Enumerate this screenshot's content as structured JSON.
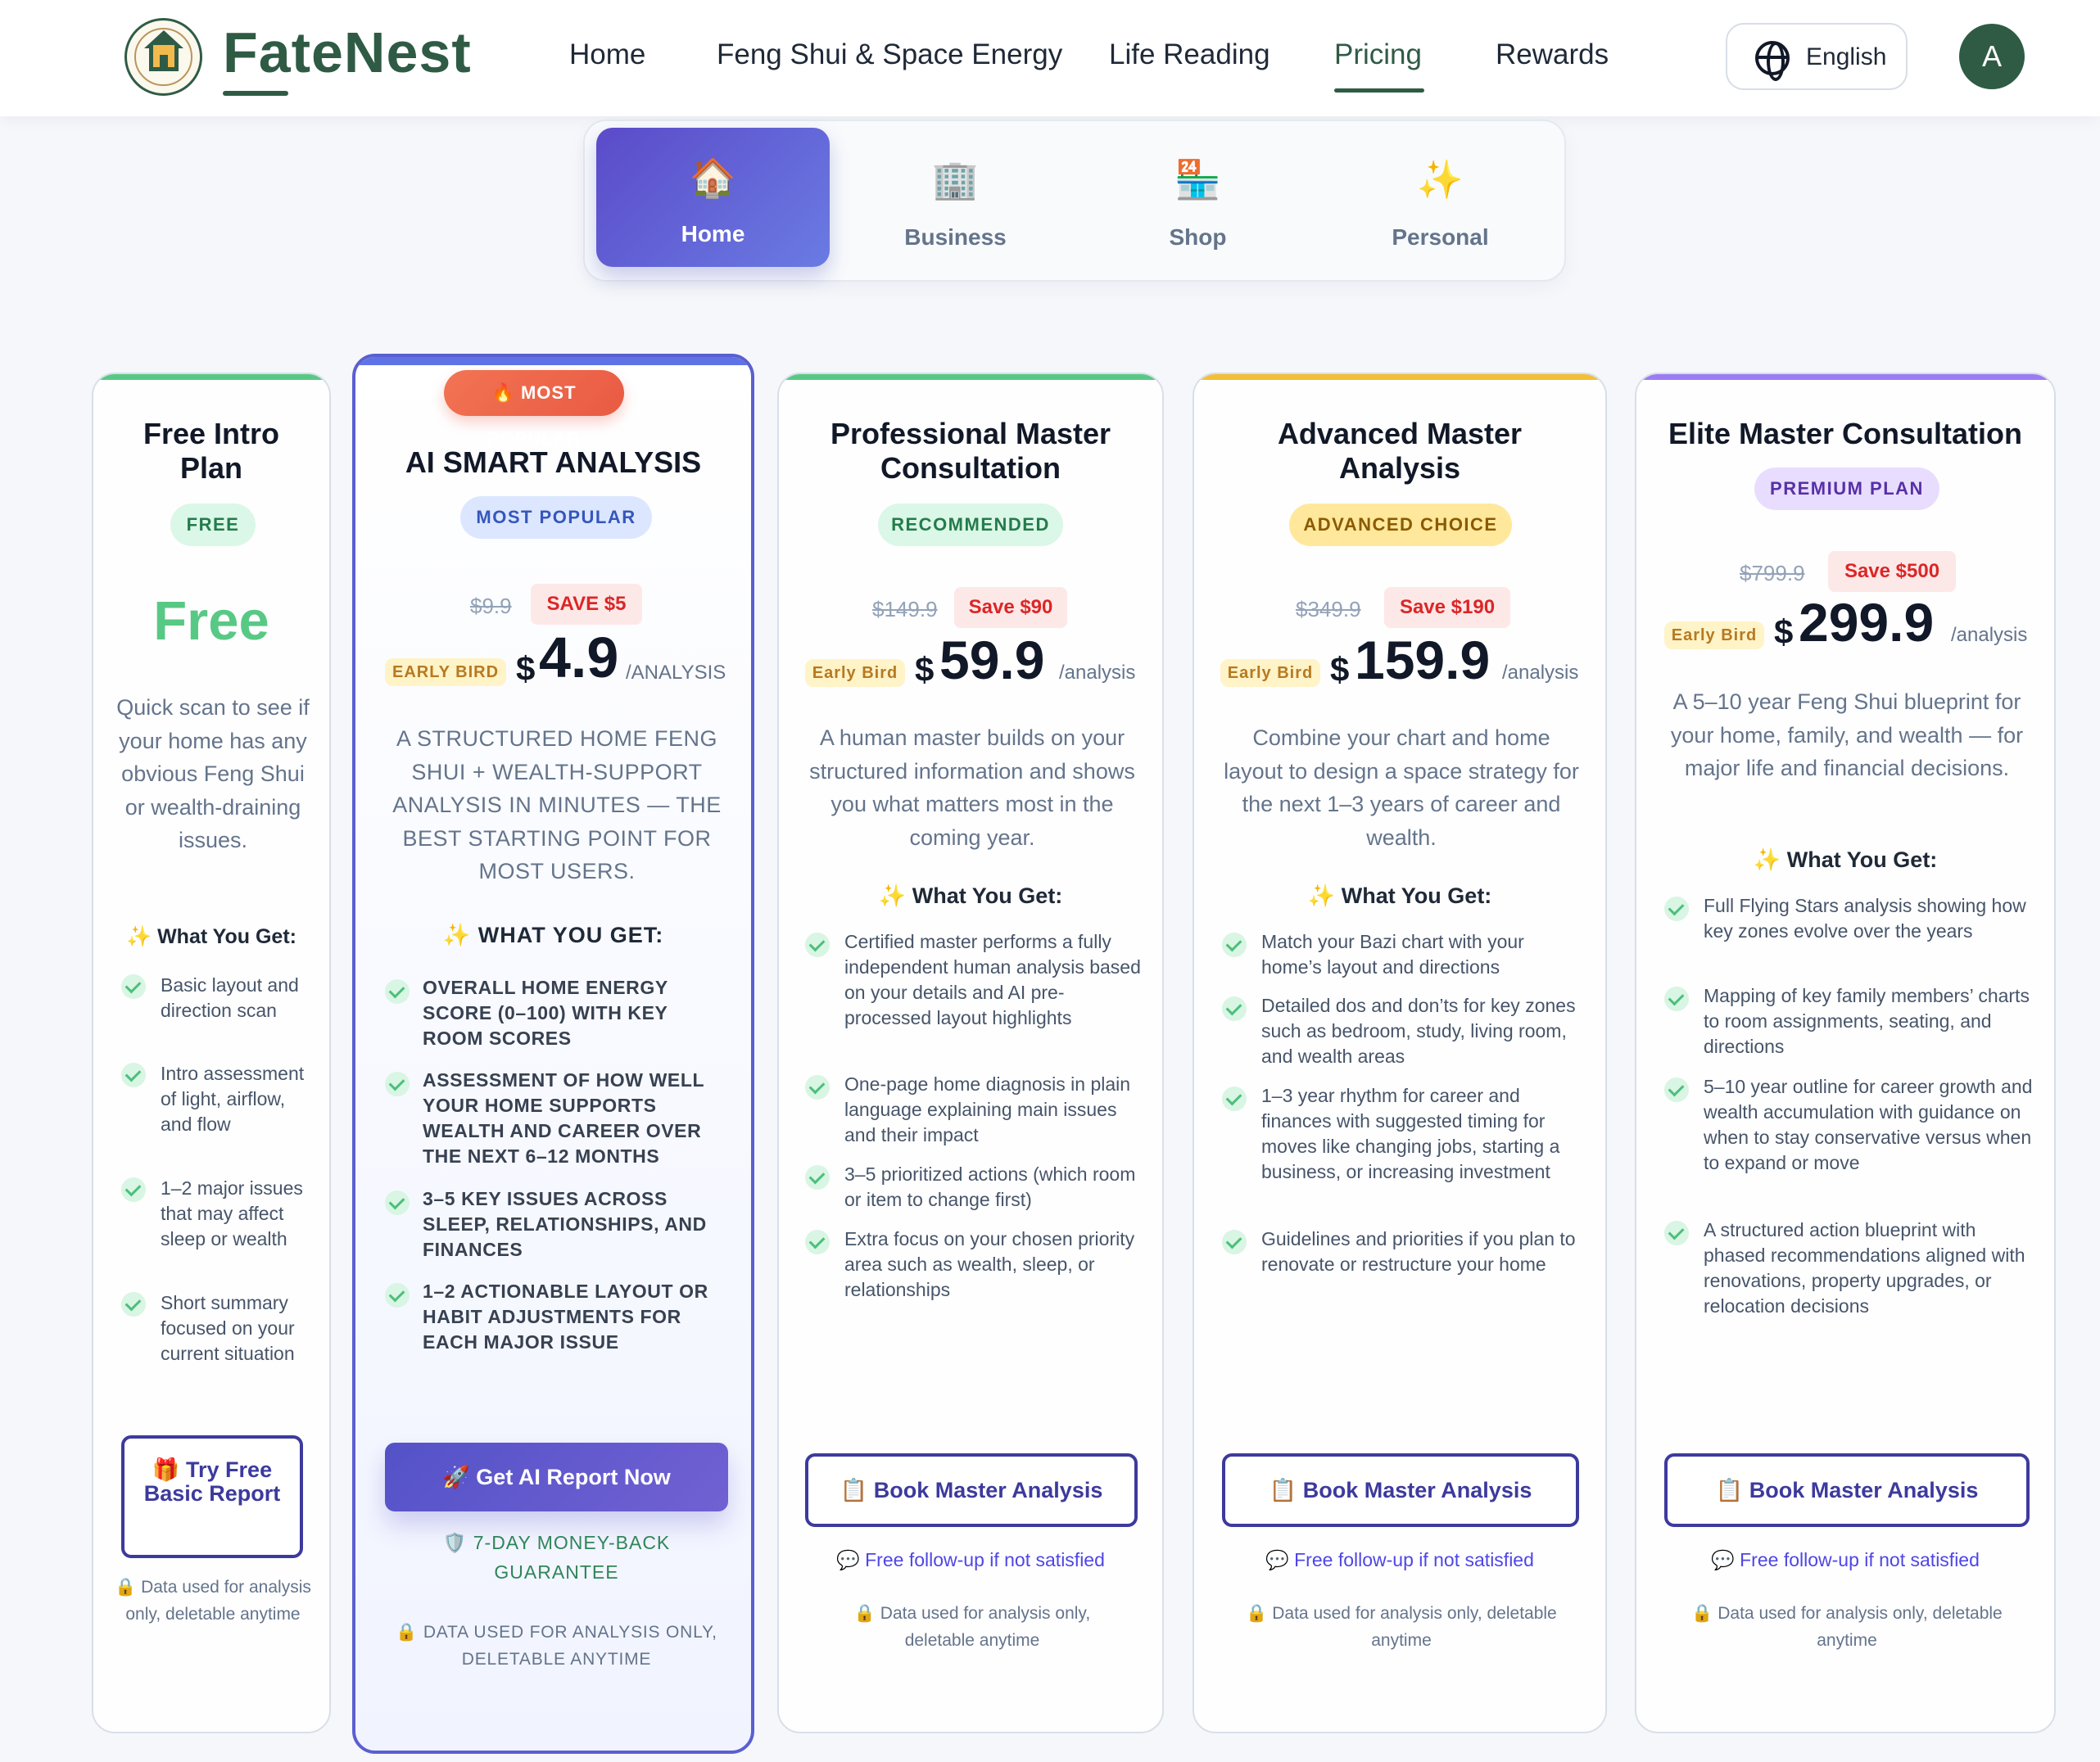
{
  "brand": {
    "name": "FateNest"
  },
  "nav": {
    "links": [
      "Home",
      "Feng Shui & Space Energy",
      "Life Reading",
      "Pricing",
      "Rewards"
    ],
    "active": "Pricing",
    "language": "English",
    "avatar": "A"
  },
  "icons": {
    "logo": "house-logo-icon",
    "globe": "globe-icon",
    "home": "house-icon",
    "business": "office-building-icon",
    "shop": "store-icon",
    "personal": "sparkles-icon",
    "check": "check-icon",
    "gift": "gift-icon",
    "rocket": "rocket-icon",
    "book": "book-icon",
    "chat": "chat-icon",
    "lock": "lock-icon",
    "shield": "shield-icon"
  },
  "colors": {
    "brand": "#2f5b45",
    "accent": "#5b4bc9",
    "success": "#58c985",
    "danger": "#dc2626",
    "warning": "#f3bf38",
    "purple": "#9b7cf3"
  },
  "segments": [
    {
      "icon": "🏠",
      "label": "Home",
      "active": true
    },
    {
      "icon": "🏢",
      "label": "Business",
      "active": false
    },
    {
      "icon": "🏪",
      "label": "Shop",
      "active": false
    },
    {
      "icon": "✨",
      "label": "Personal",
      "active": false
    }
  ],
  "plans": [
    {
      "title": "Free Intro Plan",
      "badge": "FREE",
      "price_text": "Free",
      "description": "Quick scan to see if your home has any obvious Feng Shui or wealth-draining issues.",
      "what_you_get": "✨ What You Get:",
      "features": [
        "Basic layout and direction scan",
        "Intro assessment of light, airflow, and flow",
        "1–2 major issues that may affect sleep or wealth",
        "Short summary focused on your current situation"
      ],
      "button": "🎁 Try Free Basic Report",
      "privacy": "🔒 Data used for analysis only, deletable anytime"
    },
    {
      "floating_badge": "🔥 MOST POPULAR",
      "title": "AI SMART ANALYSIS",
      "badge": "MOST POPULAR",
      "old_price": "$9.9",
      "save": "SAVE $5",
      "early_bird": "EARLY BIRD",
      "currency": "$",
      "price": "4.9",
      "unit": "/ANALYSIS",
      "description": "A STRUCTURED HOME FENG SHUI + WEALTH-SUPPORT ANALYSIS IN MINUTES — THE BEST STARTING POINT FOR MOST USERS.",
      "what_you_get": "✨ WHAT YOU GET:",
      "features": [
        "OVERALL HOME ENERGY SCORE (0–100) WITH KEY ROOM SCORES",
        "ASSESSMENT OF HOW WELL YOUR HOME SUPPORTS WEALTH AND CAREER OVER THE NEXT 6–12 MONTHS",
        "3–5 KEY ISSUES ACROSS SLEEP, RELATIONSHIPS, AND FINANCES",
        "1–2 ACTIONABLE LAYOUT OR HABIT ADJUSTMENTS FOR EACH MAJOR ISSUE"
      ],
      "button": "🚀 Get AI Report Now",
      "guarantee": "🛡️ 7-DAY MONEY-BACK GUARANTEE",
      "privacy": "🔒 DATA USED FOR ANALYSIS ONLY, DELETABLE ANYTIME"
    },
    {
      "title": "Professional Master Consultation",
      "badge": "RECOMMENDED",
      "old_price": "$149.9",
      "save": "Save $90",
      "early_bird": "Early Bird",
      "currency": "$",
      "price": "59.9",
      "unit": "/analysis",
      "description": "A human master builds on your structured information and shows you what matters most in the coming year.",
      "what_you_get": "✨ What You Get:",
      "features": [
        "Certified master performs a fully independent human analysis based on your details and AI pre-processed layout highlights",
        "One-page home diagnosis in plain language explaining main issues and their impact",
        "3–5 prioritized actions (which room or item to change first)",
        "Extra focus on your chosen priority area such as wealth, sleep, or relationships"
      ],
      "button": "📋 Book Master Analysis",
      "follow_up": "💬 Free follow-up if not satisfied",
      "privacy": "🔒 Data used for analysis only, deletable anytime"
    },
    {
      "title": "Advanced Master Analysis",
      "badge": "ADVANCED CHOICE",
      "old_price": "$349.9",
      "save": "Save $190",
      "early_bird": "Early Bird",
      "currency": "$",
      "price": "159.9",
      "unit": "/analysis",
      "description": "Combine your chart and home layout to design a space strategy for the next 1–3 years of career and wealth.",
      "what_you_get": "✨ What You Get:",
      "features": [
        "Match your Bazi chart with your home’s layout and directions",
        "Detailed dos and don’ts for key zones such as bedroom, study, living room, and wealth areas",
        "1–3 year rhythm for career and finances with suggested timing for moves like changing jobs, starting a business, or increasing investment",
        "Guidelines and priorities if you plan to renovate or restructure your home"
      ],
      "button": "📋 Book Master Analysis",
      "follow_up": "💬 Free follow-up if not satisfied",
      "privacy": "🔒 Data used for analysis only, deletable anytime"
    },
    {
      "title": "Elite Master Consultation",
      "badge": "PREMIUM PLAN",
      "old_price": "$799.9",
      "save": "Save $500",
      "early_bird": "Early Bird",
      "currency": "$",
      "price": "299.9",
      "unit": "/analysis",
      "description": "A 5–10 year Feng Shui blueprint for your home, family, and wealth — for major life and financial decisions.",
      "what_you_get": "✨ What You Get:",
      "features": [
        "Full Flying Stars analysis showing how key zones evolve over the years",
        "Mapping of key family members’ charts to room assignments, seating, and directions",
        "5–10 year outline for career growth and wealth accumulation with guidance on when to stay conservative versus when to expand or move",
        "A structured action blueprint with phased recommendations aligned with renovations, property upgrades, or relocation decisions"
      ],
      "button": "📋 Book Master Analysis",
      "follow_up": "💬 Free follow-up if not satisfied",
      "privacy": "🔒 Data used for analysis only, deletable anytime"
    }
  ]
}
